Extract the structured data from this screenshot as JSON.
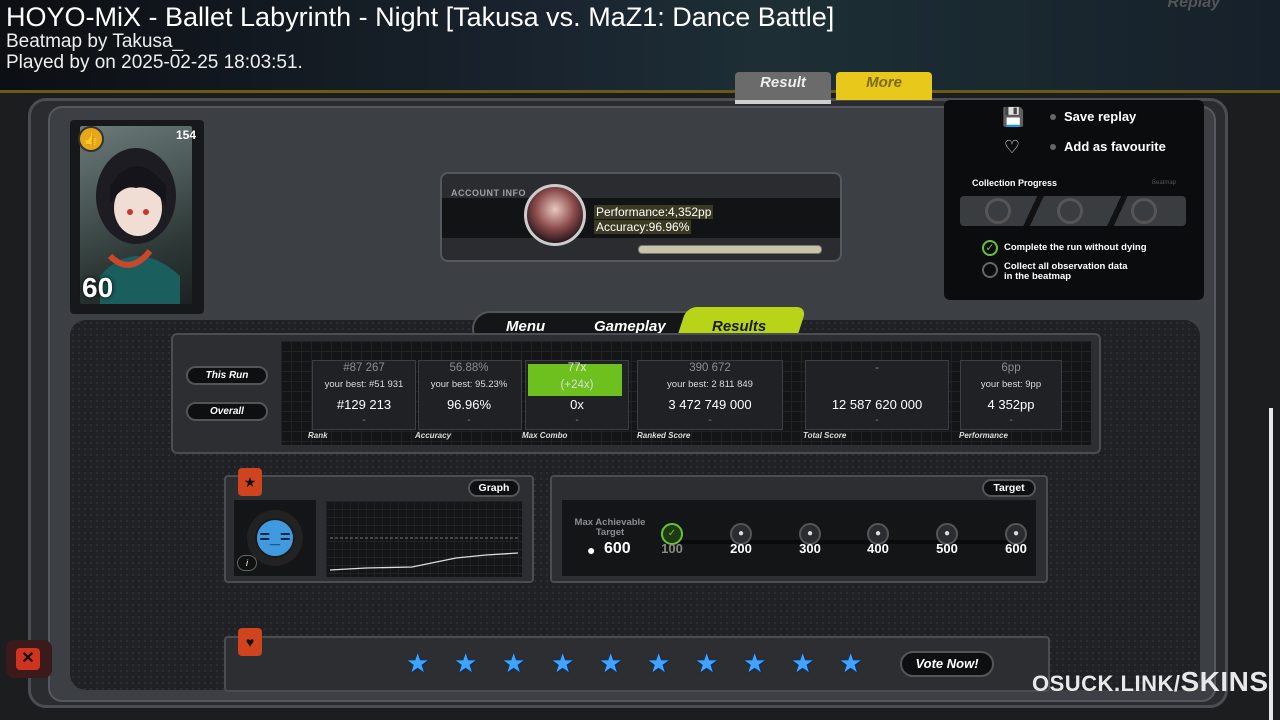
{
  "header": {
    "title": "HOYO-MiX - Ballet Labyrinth - Night [Takusa vs. MaZ1: Dance Battle]",
    "beatmap_by": "Beatmap by Takusa_",
    "played_by": "Played by  on 2025-02-25 18:03:51.",
    "replay_faded": "Replay"
  },
  "top_tabs": {
    "result": "Result",
    "more": "More"
  },
  "avatar": {
    "count": "154",
    "level": "60"
  },
  "account": {
    "label": "ACCOUNT INFO",
    "performance": "Performance:4,352pp",
    "accuracy": "Accuracy:96.96%"
  },
  "more_panel": {
    "save_replay": "Save replay",
    "add_favourite": "Add as favourite",
    "collection_progress": "Collection Progress",
    "collection_beatmap": "Beatmap",
    "check1": "Complete the run without dying",
    "check2_line1": "Collect all observation data",
    "check2_line2": "in the beatmap"
  },
  "main_tabs": {
    "menu": "Menu",
    "gameplay": "Gameplay",
    "results": "Results"
  },
  "side_buttons": {
    "this_run": "This Run",
    "overall": "Overall"
  },
  "stats": [
    {
      "label": "Rank",
      "top": "#87 267",
      "best": "your best: #51 931",
      "main": "#129 213",
      "dash": "-"
    },
    {
      "label": "Accuracy",
      "top": "56.88%",
      "best": "your best: 95.23%",
      "main": "96.96%",
      "dash": "-"
    },
    {
      "label": "Max Combo",
      "top": "77x",
      "best": "(+24x)",
      "main": "0x",
      "dash": "-"
    },
    {
      "label": "Ranked Score",
      "top": "390 672",
      "best": "your best: 2 811 849",
      "main": "3 472 749 000",
      "dash": "-"
    },
    {
      "label": "Total Score",
      "top": "-",
      "best": "",
      "main": "12 587 620 000",
      "dash": "-"
    },
    {
      "label": "Performance",
      "top": "6pp",
      "best": "your best: 9pp",
      "main": "4 352pp",
      "dash": "-"
    }
  ],
  "graph": {
    "button": "Graph",
    "info": "i"
  },
  "target": {
    "button": "Target",
    "label_line1": "Max Achievable",
    "label_line2": "Target",
    "max_value": "600",
    "nodes": [
      "100",
      "200",
      "300",
      "400",
      "500",
      "600"
    ]
  },
  "vote": {
    "button": "Vote Now!",
    "star_count": 10
  },
  "watermark": {
    "prefix": "OSUCK.LINK/",
    "suffix": "SKINS"
  },
  "colors": {
    "accent": "#b8d418",
    "more_tab": "#e8c81b",
    "star": "#3fa4ff",
    "danger": "#d0431f"
  }
}
